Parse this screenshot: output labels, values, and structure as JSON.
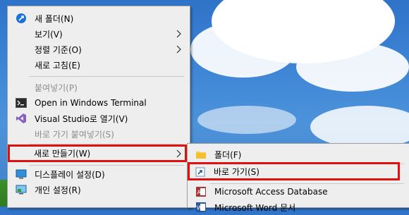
{
  "context_menu": {
    "items": [
      {
        "label": "새 폴더(N)",
        "icon": "new-folder-icon"
      },
      {
        "label": "보기(V)",
        "submenu": true
      },
      {
        "label": "정렬 기준(O)",
        "submenu": true
      },
      {
        "label": "새로 고침(E)"
      },
      {
        "label": "붙여넣기(P)",
        "disabled": true
      },
      {
        "label": "Open in Windows Terminal",
        "icon": "terminal-icon"
      },
      {
        "label": "Visual Studio로 열기(V)",
        "icon": "visual-studio-icon"
      },
      {
        "label": "바로 가기 붙여넣기(S)",
        "disabled": true
      },
      {
        "label": "새로 만들기(W)",
        "submenu": true,
        "highlighted": true
      },
      {
        "label": "디스플레이 설정(D)",
        "icon": "display-icon"
      },
      {
        "label": "개인 설정(R)",
        "icon": "personalize-icon"
      }
    ]
  },
  "new_submenu": {
    "items": [
      {
        "label": "폴더(F)",
        "icon": "folder-icon"
      },
      {
        "label": "바로 가기(S)",
        "icon": "shortcut-icon",
        "highlighted": true
      },
      {
        "label": "Microsoft Access Database",
        "icon": "access-icon"
      },
      {
        "label": "Microsoft Word 문서",
        "icon": "word-icon"
      }
    ]
  },
  "colors": {
    "highlight_border": "#e01010",
    "menu_background": "#eeeeee",
    "disabled_text": "#8d8d8d"
  }
}
